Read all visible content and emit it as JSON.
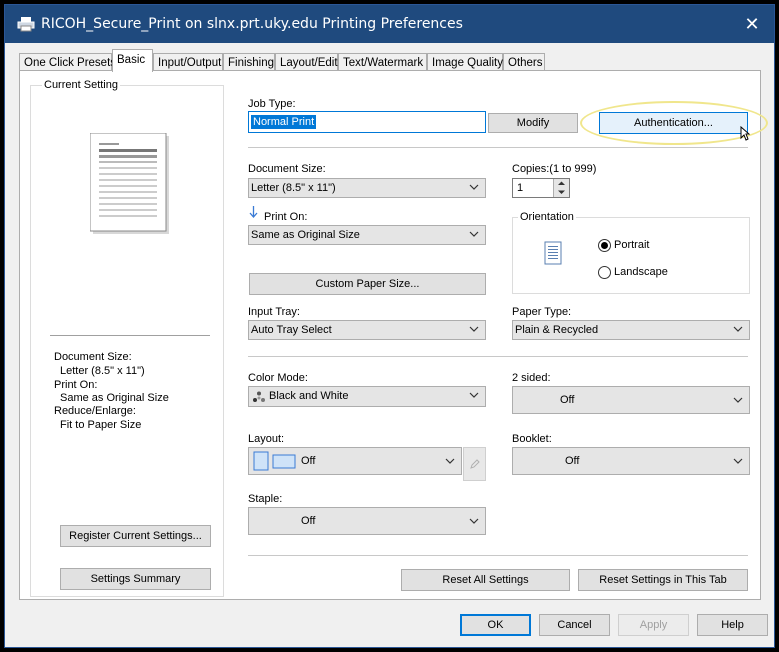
{
  "window": {
    "title": "RICOH_Secure_Print on slnx.prt.uky.edu Printing Preferences",
    "close_glyph": "✕"
  },
  "tabs": [
    {
      "label": "One Click Presets"
    },
    {
      "label": "Basic"
    },
    {
      "label": "Input/Output"
    },
    {
      "label": "Finishing"
    },
    {
      "label": "Layout/Edit"
    },
    {
      "label": "Text/Watermark"
    },
    {
      "label": "Image Quality"
    },
    {
      "label": "Others"
    }
  ],
  "current_setting": {
    "title": "Current Setting",
    "summary": [
      "Document Size:",
      "Letter (8.5\" x 11\")",
      "Print On:",
      "Same as Original Size",
      "Reduce/Enlarge:",
      "Fit to Paper Size"
    ],
    "register_label": "Register Current Settings...",
    "summary_label": "Settings Summary"
  },
  "job_type": {
    "label": "Job Type:",
    "value": "Normal Print",
    "modify_label": "Modify",
    "auth_label": "Authentication..."
  },
  "document_size": {
    "label": "Document Size:",
    "value": "Letter (8.5\" x 11\")"
  },
  "copies": {
    "label": "Copies:(1 to 999)",
    "value": "1"
  },
  "print_on": {
    "label": "Print On:",
    "value": "Same as Original Size"
  },
  "orientation": {
    "title": "Orientation",
    "portrait": "Portrait",
    "landscape": "Landscape"
  },
  "custom_paper_label": "Custom Paper Size...",
  "input_tray": {
    "label": "Input Tray:",
    "value": "Auto Tray Select"
  },
  "paper_type": {
    "label": "Paper Type:",
    "value": "Plain & Recycled"
  },
  "color_mode": {
    "label": "Color Mode:",
    "value": "Black and White"
  },
  "two_sided": {
    "label": "2 sided:",
    "value": "Off"
  },
  "layout": {
    "label": "Layout:",
    "value": "Off"
  },
  "booklet": {
    "label": "Booklet:",
    "value": "Off"
  },
  "staple": {
    "label": "Staple:",
    "value": "Off"
  },
  "reset_all_label": "Reset All Settings",
  "reset_tab_label": "Reset Settings in This Tab",
  "footer": {
    "ok": "OK",
    "cancel": "Cancel",
    "apply": "Apply",
    "help": "Help"
  },
  "colors": {
    "title_bar": "#1f4a7e",
    "highlight": "#e5f1fb",
    "accent": "#0078d7",
    "callout": "#f0e68c"
  }
}
